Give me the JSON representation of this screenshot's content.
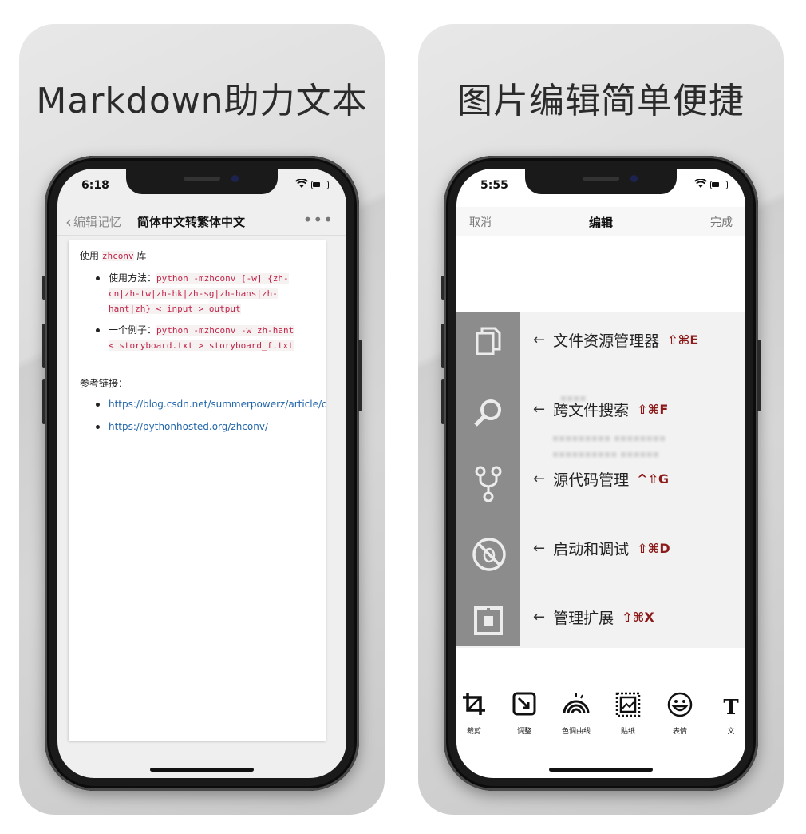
{
  "left_card": {
    "title": "Markdown助力文本",
    "status_time": "6:18",
    "nav": {
      "back_label": "编辑记忆",
      "title": "简体中文转繁体中文",
      "more": "•••"
    },
    "doc": {
      "p1_prefix": "使用 ",
      "p1_code": "zhconv",
      "p1_suffix": " 库",
      "items": [
        {
          "label": "使用方法：",
          "code": "python -mzhconv [-w] {zh-cn|zh-tw|zh-hk|zh-sg|zh-hans|zh-hant|zh} < input > output"
        },
        {
          "label": "一个例子：",
          "code": "python -mzhconv -w zh-hant < storyboard.txt > storyboard_f.txt"
        }
      ],
      "p2": "参考链接：",
      "links": [
        "https://blog.csdn.net/summerpowerz/article/de",
        "https://pythonhosted.org/zhconv/"
      ]
    }
  },
  "right_card": {
    "title": "图片编辑简单便捷",
    "status_time": "5:55",
    "nav": {
      "cancel": "取消",
      "title": "编辑",
      "done": "完成"
    },
    "hints": [
      {
        "label": "文件资源管理器",
        "key": "⇧⌘E"
      },
      {
        "label": "跨文件搜索",
        "key": "⇧⌘F"
      },
      {
        "label": "源代码管理",
        "key": "^⇧G"
      },
      {
        "label": "启动和调试",
        "key": "⇧⌘D"
      },
      {
        "label": "管理扩展",
        "key": "⇧⌘X"
      }
    ],
    "tools": [
      {
        "label": "裁剪",
        "icon": "crop-icon"
      },
      {
        "label": "调整",
        "icon": "adjust-icon"
      },
      {
        "label": "色调曲线",
        "icon": "tone-curve-icon"
      },
      {
        "label": "贴纸",
        "icon": "sticker-icon"
      },
      {
        "label": "表情",
        "icon": "emoji-icon"
      },
      {
        "label": "文",
        "icon": "text-icon"
      }
    ],
    "activity_icons": [
      "files-icon",
      "search-icon",
      "source-control-icon",
      "debug-icon",
      "extensions-icon"
    ]
  }
}
